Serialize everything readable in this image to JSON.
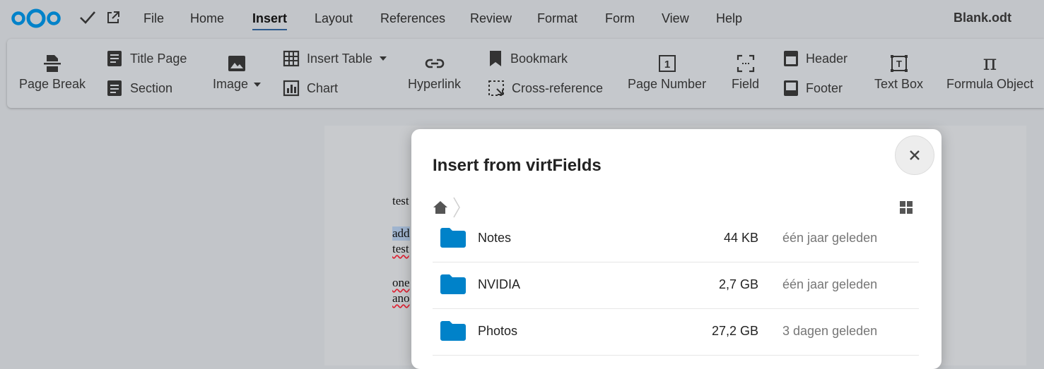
{
  "menu": {
    "items": [
      {
        "label": "File"
      },
      {
        "label": "Home"
      },
      {
        "label": "Insert",
        "active": true
      },
      {
        "label": "Layout"
      },
      {
        "label": "References"
      },
      {
        "label": "Review"
      },
      {
        "label": "Format"
      },
      {
        "label": "Form"
      },
      {
        "label": "View"
      },
      {
        "label": "Help"
      }
    ],
    "document_title": "Blank.odt"
  },
  "ribbon": {
    "page_break": "Page Break",
    "title_page": "Title Page",
    "section": "Section",
    "image": "Image",
    "insert_table": "Insert Table",
    "chart": "Chart",
    "hyperlink": "Hyperlink",
    "bookmark": "Bookmark",
    "cross_reference": "Cross-reference",
    "page_number": "Page Number",
    "page_number_glyph": "1",
    "field": "Field",
    "header": "Header",
    "footer": "Footer",
    "text_box": "Text Box",
    "text_box_glyph": "T",
    "formula_object": "Formula Object",
    "formula_glyph": "π"
  },
  "document": {
    "lines": [
      "test",
      "add",
      "test",
      "one",
      "ano"
    ]
  },
  "dialog": {
    "title": "Insert from virtFields",
    "files": [
      {
        "name": "Notes",
        "size": "44 KB",
        "modified": "één jaar geleden"
      },
      {
        "name": "NVIDIA",
        "size": "2,7 GB",
        "modified": "één jaar geleden"
      },
      {
        "name": "Photos",
        "size": "27,2 GB",
        "modified": "3 dagen geleden"
      }
    ]
  },
  "colors": {
    "accent": "#0082c9",
    "folder": "#0082c9",
    "logo": "#0082c9"
  }
}
